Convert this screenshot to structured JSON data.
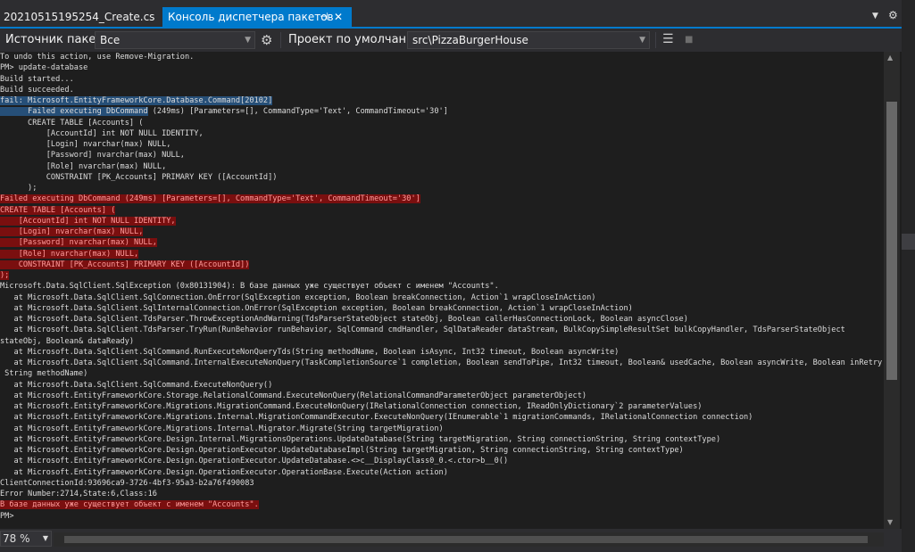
{
  "tabs": {
    "file_tab": "20210515195254_Create.cs",
    "console_tab": "Консоль диспетчера пакетов",
    "pin_glyph": "⊣",
    "close_glyph": "✕",
    "dropdown_glyph": "▼",
    "gear_glyph": "⚙"
  },
  "toolbar": {
    "source_label": "Источник пакета:",
    "source_value": "Все",
    "project_label": "Проект по умолчанию:",
    "project_value": "src\\PizzaBurgerHouse",
    "settings_glyph": "⚙",
    "clear_glyph": "☰",
    "stop_glyph": "■"
  },
  "console": {
    "lines": [
      {
        "text": "To undo this action, use Remove-Migration.",
        "style": "normal"
      },
      {
        "text": "PM> update-database",
        "style": "normal"
      },
      {
        "text": "Build started...",
        "style": "normal"
      },
      {
        "text": "Build succeeded.",
        "style": "normal"
      },
      {
        "text": "fail: Microsoft.EntityFrameworkCore.Database.Command[20102]",
        "style": "highlight"
      },
      {
        "text": "      Failed executing DbCommand (249ms) [Parameters=[], CommandType='Text', CommandTimeout='30']",
        "style": "normal",
        "hl_prefix": "      Failed executing DbCommand"
      },
      {
        "text": "      CREATE TABLE [Accounts] (",
        "style": "normal"
      },
      {
        "text": "          [AccountId] int NOT NULL IDENTITY,",
        "style": "normal"
      },
      {
        "text": "          [Login] nvarchar(max) NULL,",
        "style": "normal"
      },
      {
        "text": "          [Password] nvarchar(max) NULL,",
        "style": "normal"
      },
      {
        "text": "          [Role] nvarchar(max) NULL,",
        "style": "normal"
      },
      {
        "text": "          CONSTRAINT [PK_Accounts] PRIMARY KEY ([AccountId])",
        "style": "normal"
      },
      {
        "text": "      );",
        "style": "normal"
      },
      {
        "text": "Failed executing DbCommand (249ms) [Parameters=[], CommandType='Text', CommandTimeout='30']",
        "style": "error"
      },
      {
        "text": "CREATE TABLE [Accounts] (",
        "style": "error"
      },
      {
        "text": "    [AccountId] int NOT NULL IDENTITY,",
        "style": "error"
      },
      {
        "text": "    [Login] nvarchar(max) NULL,",
        "style": "error"
      },
      {
        "text": "    [Password] nvarchar(max) NULL,",
        "style": "error"
      },
      {
        "text": "    [Role] nvarchar(max) NULL,",
        "style": "error"
      },
      {
        "text": "    CONSTRAINT [PK_Accounts] PRIMARY KEY ([AccountId])",
        "style": "error"
      },
      {
        "text": ");",
        "style": "error"
      },
      {
        "text": "Microsoft.Data.SqlClient.SqlException (0x80131904): В базе данных уже существует объект с именем \"Accounts\".",
        "style": "normal"
      },
      {
        "text": "   at Microsoft.Data.SqlClient.SqlConnection.OnError(SqlException exception, Boolean breakConnection, Action`1 wrapCloseInAction)",
        "style": "normal"
      },
      {
        "text": "   at Microsoft.Data.SqlClient.SqlInternalConnection.OnError(SqlException exception, Boolean breakConnection, Action`1 wrapCloseInAction)",
        "style": "normal"
      },
      {
        "text": "   at Microsoft.Data.SqlClient.TdsParser.ThrowExceptionAndWarning(TdsParserStateObject stateObj, Boolean callerHasConnectionLock, Boolean asyncClose)",
        "style": "normal"
      },
      {
        "text": "   at Microsoft.Data.SqlClient.TdsParser.TryRun(RunBehavior runBehavior, SqlCommand cmdHandler, SqlDataReader dataStream, BulkCopySimpleResultSet bulkCopyHandler, TdsParserStateObject",
        "style": "normal"
      },
      {
        "text": "stateObj, Boolean& dataReady)",
        "style": "normal"
      },
      {
        "text": "   at Microsoft.Data.SqlClient.SqlCommand.RunExecuteNonQueryTds(String methodName, Boolean isAsync, Int32 timeout, Boolean asyncWrite)",
        "style": "normal"
      },
      {
        "text": "   at Microsoft.Data.SqlClient.SqlCommand.InternalExecuteNonQuery(TaskCompletionSource`1 completion, Boolean sendToPipe, Int32 timeout, Boolean& usedCache, Boolean asyncWrite, Boolean inRetry,",
        "style": "normal"
      },
      {
        "text": " String methodName)",
        "style": "normal"
      },
      {
        "text": "   at Microsoft.Data.SqlClient.SqlCommand.ExecuteNonQuery()",
        "style": "normal"
      },
      {
        "text": "   at Microsoft.EntityFrameworkCore.Storage.RelationalCommand.ExecuteNonQuery(RelationalCommandParameterObject parameterObject)",
        "style": "normal"
      },
      {
        "text": "   at Microsoft.EntityFrameworkCore.Migrations.MigrationCommand.ExecuteNonQuery(IRelationalConnection connection, IReadOnlyDictionary`2 parameterValues)",
        "style": "normal"
      },
      {
        "text": "   at Microsoft.EntityFrameworkCore.Migrations.Internal.MigrationCommandExecutor.ExecuteNonQuery(IEnumerable`1 migrationCommands, IRelationalConnection connection)",
        "style": "normal"
      },
      {
        "text": "   at Microsoft.EntityFrameworkCore.Migrations.Internal.Migrator.Migrate(String targetMigration)",
        "style": "normal"
      },
      {
        "text": "   at Microsoft.EntityFrameworkCore.Design.Internal.MigrationsOperations.UpdateDatabase(String targetMigration, String connectionString, String contextType)",
        "style": "normal"
      },
      {
        "text": "   at Microsoft.EntityFrameworkCore.Design.OperationExecutor.UpdateDatabaseImpl(String targetMigration, String connectionString, String contextType)",
        "style": "normal"
      },
      {
        "text": "   at Microsoft.EntityFrameworkCore.Design.OperationExecutor.UpdateDatabase.<>c__DisplayClass0_0.<.ctor>b__0()",
        "style": "normal"
      },
      {
        "text": "   at Microsoft.EntityFrameworkCore.Design.OperationExecutor.OperationBase.Execute(Action action)",
        "style": "normal"
      },
      {
        "text": "ClientConnectionId:93696ca9-3726-4bf3-95a3-b2a76f490083",
        "style": "normal"
      },
      {
        "text": "Error Number:2714,State:6,Class:16",
        "style": "normal"
      },
      {
        "text": "В базе данных уже существует объект с именем \"Accounts\".",
        "style": "error"
      },
      {
        "text": "PM>",
        "style": "normal"
      }
    ]
  },
  "status": {
    "zoom": "78 %"
  },
  "colors": {
    "accent": "#007acc",
    "error_bg": "#7a0f0f",
    "selection_bg": "#264f78"
  }
}
